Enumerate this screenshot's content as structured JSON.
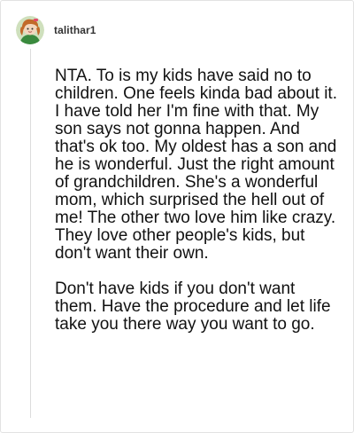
{
  "post": {
    "username": "talithar1",
    "avatar_icon": "cartoon-character-avatar-icon",
    "paragraphs": [
      "NTA. To is my kids have said no to children. One feels kinda bad about it. I have told her I'm fine with that. My son says not gonna happen. And that's ok too. My oldest has a son and he is wonderful. Just the right amount of grandchildren. She's a wonderful mom, which surprised the hell out of me! The other two love him like crazy. They love other people's kids, but don't want their own.",
      "Don't have kids if you don't want them. Have the procedure and let life take you there way you want to go."
    ]
  },
  "colors": {
    "border": "#e2e2e2",
    "thread_line": "#dcdcdc",
    "text": "#111111",
    "username": "#333333",
    "avatar_bg": "#cfe0bd",
    "avatar_hair": "#c26a2a",
    "avatar_shirt": "#3a8a3e"
  }
}
